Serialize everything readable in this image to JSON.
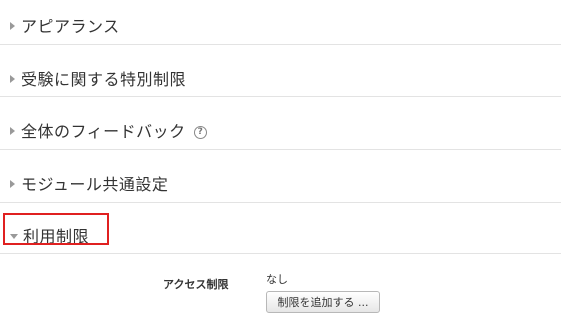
{
  "sections": [
    {
      "label": "アピアランス",
      "expanded": false,
      "help": false
    },
    {
      "label": "受験に関する特別制限",
      "expanded": false,
      "help": false
    },
    {
      "label": "全体のフィードバック",
      "expanded": false,
      "help": true
    },
    {
      "label": "モジュール共通設定",
      "expanded": false,
      "help": false
    },
    {
      "label": "利用制限",
      "expanded": true,
      "help": false
    }
  ],
  "help_icon_glyph": "?",
  "highlight_color": "#e02020",
  "access_restriction": {
    "label": "アクセス制限",
    "value": "なし",
    "add_button_label": "制限を追加する ..."
  }
}
